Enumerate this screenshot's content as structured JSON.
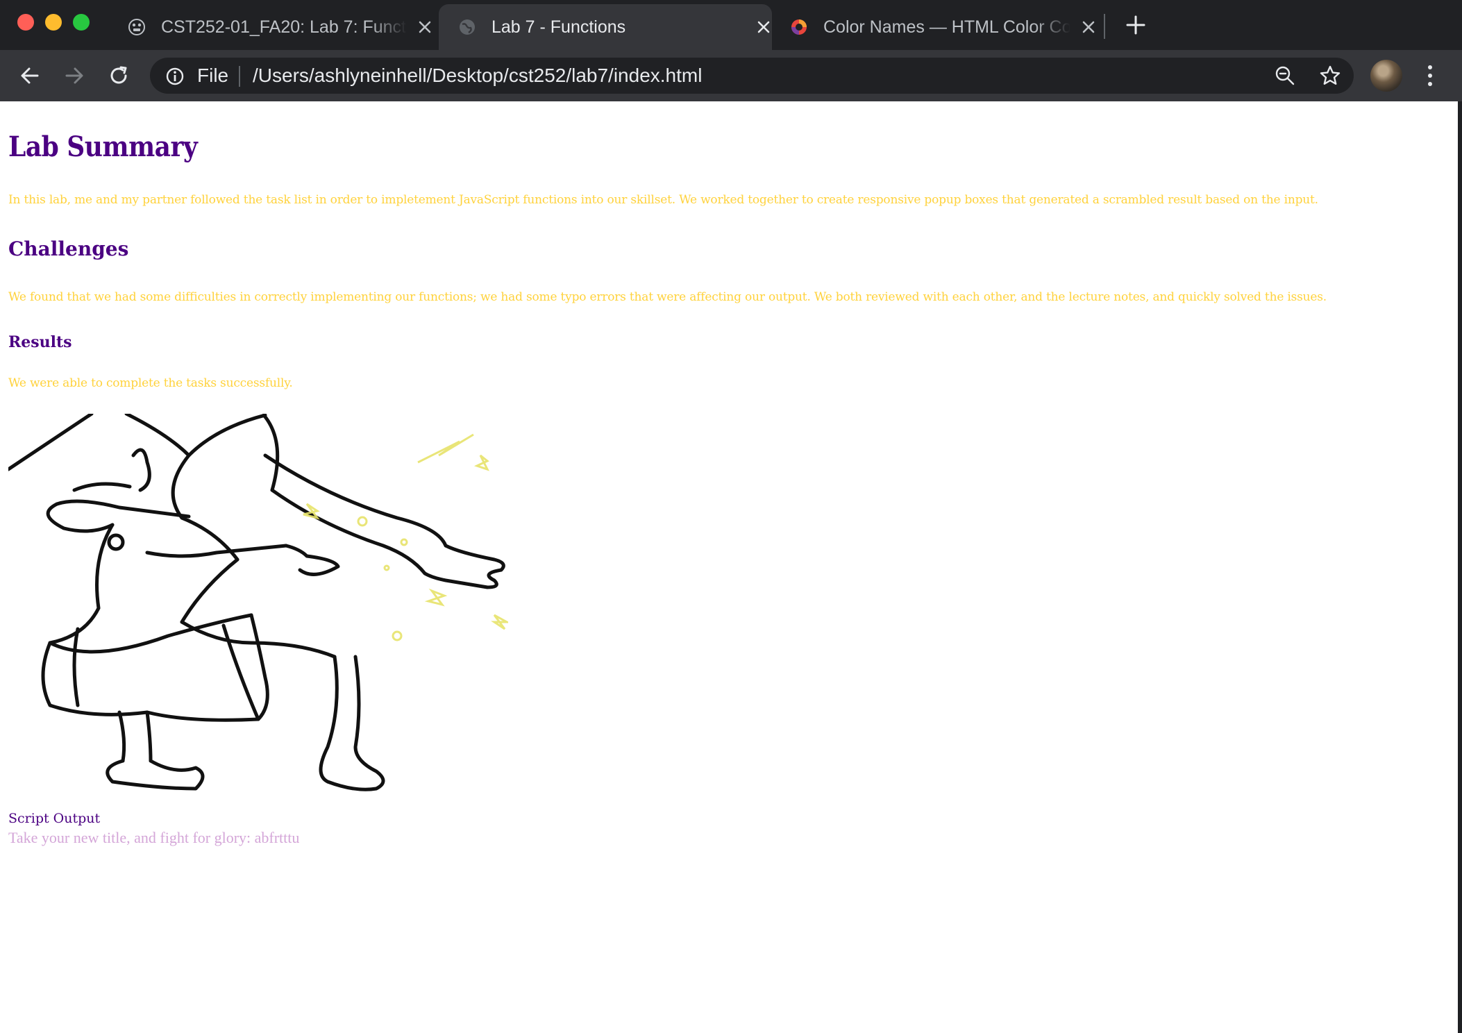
{
  "browser": {
    "tabs": [
      {
        "title": "CST252-01_FA20: Lab 7: Functi",
        "active": false
      },
      {
        "title": "Lab 7 - Functions",
        "active": true
      },
      {
        "title": "Color Names — HTML Color Co",
        "active": false
      }
    ],
    "omnibox": {
      "scheme_label": "File",
      "url": "/Users/ashlyneinhell/Desktop/cst252/lab7/index.html"
    }
  },
  "page": {
    "heading": "Lab Summary",
    "summary": "In this lab, me and my partner followed the task list in order to impletement JavaScript functions into our skillset. We worked together to create responsive popup boxes that generated a scrambled result based on the input.",
    "challenges_heading": "Challenges",
    "challenges": "We found that we had some difficulties in correctly implementing our functions; we had some typo errors that were affecting our output. We both reviewed with each other, and the lecture notes, and quickly solved the issues.",
    "results_heading": "Results",
    "results": "We were able to complete the tasks successfully.",
    "output_label": "Script Output",
    "output_text": "Take your new title, and fight for glory: abfrtttu"
  },
  "colors": {
    "heading": "#4b0082",
    "body_text": "#ffd23c",
    "output_text": "#d4a6d8",
    "chrome_dark": "#202124",
    "chrome_toolbar": "#35363a"
  }
}
